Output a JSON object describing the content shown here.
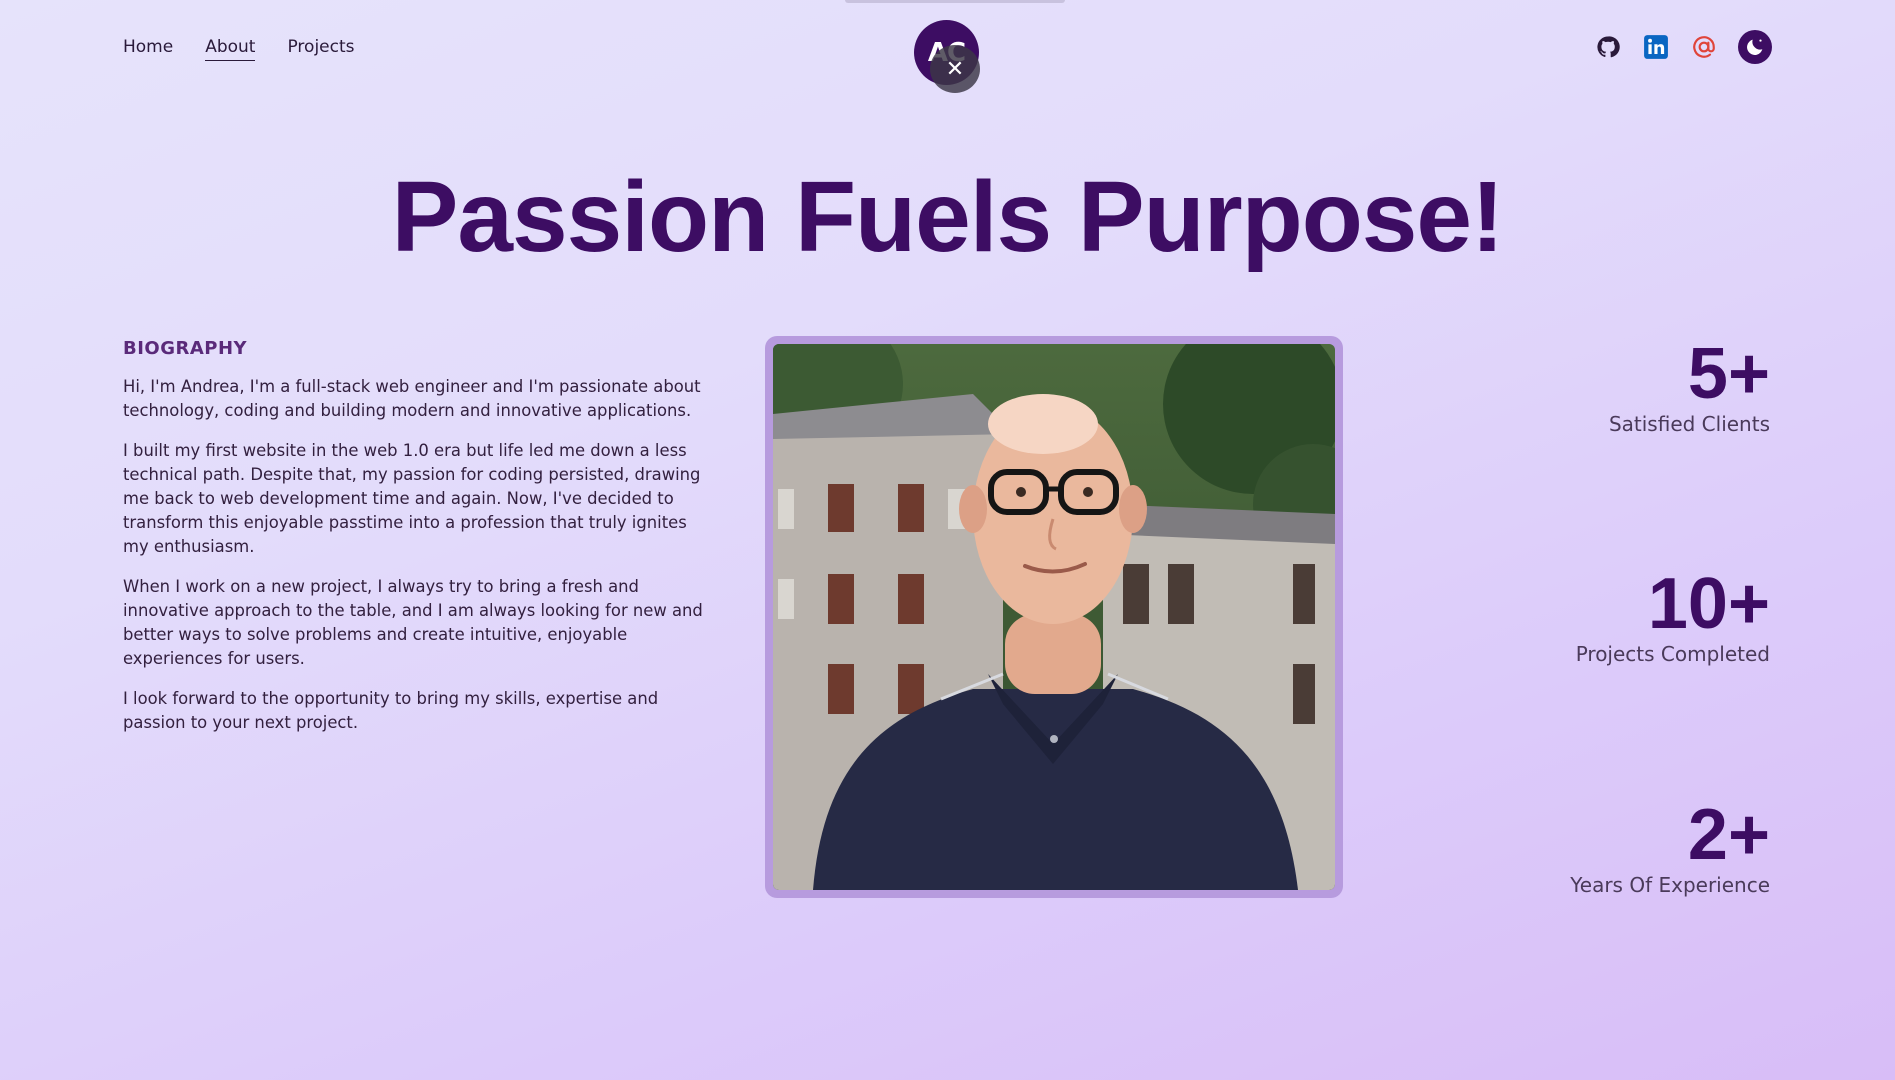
{
  "nav": {
    "items": [
      {
        "label": "Home"
      },
      {
        "label": "About"
      },
      {
        "label": "Projects"
      }
    ]
  },
  "logo": {
    "text": "AC"
  },
  "overlay": {
    "close_glyph": "✕"
  },
  "social": {
    "icons": [
      "github-icon",
      "linkedin-icon",
      "email-at-icon",
      "moon-icon"
    ],
    "colors": {
      "github": "#2a1a3a",
      "linkedin": "#0a66c2",
      "email": "#e0443a",
      "theme": "#3d0d63"
    }
  },
  "headline": "Passion Fuels Purpose!",
  "bio": {
    "heading": "BIOGRAPHY",
    "paragraphs": [
      "Hi, I'm Andrea, I'm a full-stack web engineer and I'm passionate about technology, coding and building modern and innovative applications.",
      "I built my first website in the web 1.0 era but life led me down a less technical path. Despite that, my passion for coding persisted, drawing me back to web development time and again. Now, I've decided to transform this enjoyable passtime into a profession that truly ignites my enthusiasm.",
      "When I work on a new project, I always try to bring a fresh and innovative approach to the table, and I am always looking for new and better ways to solve problems and create intuitive, enjoyable experiences for users.",
      "I look forward to the opportunity to bring my skills, expertise and passion to your next project."
    ]
  },
  "stats": [
    {
      "value": "5+",
      "label": "Satisfied Clients"
    },
    {
      "value": "10+",
      "label": "Projects Completed"
    },
    {
      "value": "2+",
      "label": "Years Of Experience"
    }
  ],
  "colors": {
    "accent": "#3d0d63",
    "frame": "#b79bde"
  }
}
